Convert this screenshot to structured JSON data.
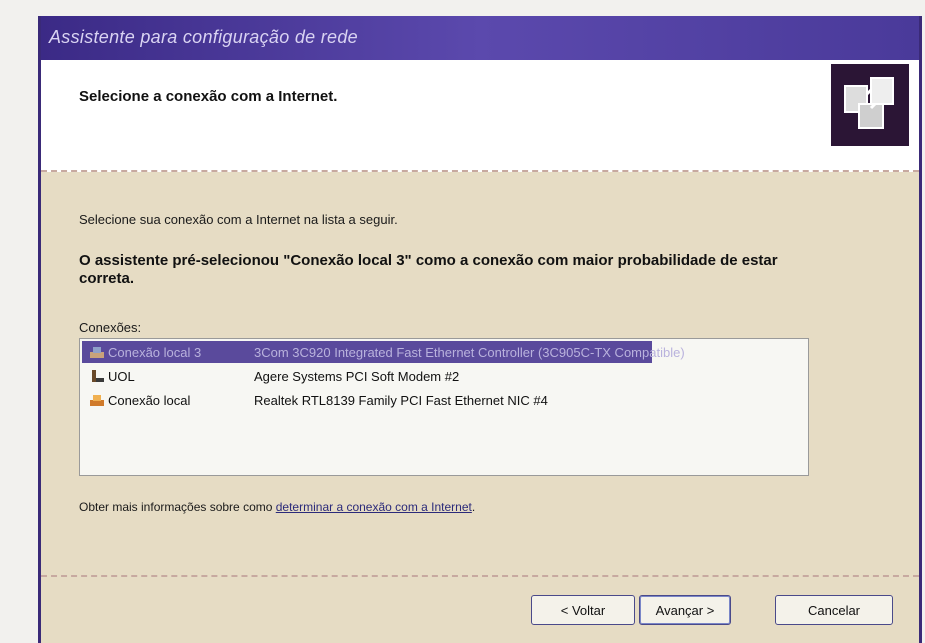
{
  "window": {
    "title": "Assistente para configuração de rede"
  },
  "header": {
    "title": "Selecione a conexão com a Internet.",
    "icon": "network-wizard-icon"
  },
  "content": {
    "intro": "Selecione sua conexão com a Internet na lista a seguir.",
    "note": "O assistente pré-selecionou \"Conexão local 3\" como a conexão com maior probabilidade de estar correta.",
    "list_label": "Conexões:",
    "connections": [
      {
        "name": "Conexão local 3",
        "device": "3Com 3C920 Integrated Fast Ethernet Controller (3C905C-TX Compatible)",
        "icon": "lan-connection-icon",
        "selected": true
      },
      {
        "name": "UOL",
        "device": "Agere Systems PCI Soft Modem #2",
        "icon": "dialup-connection-icon",
        "selected": false
      },
      {
        "name": "Conexão local",
        "device": "Realtek RTL8139 Family PCI Fast Ethernet NIC #4",
        "icon": "lan-connection-icon",
        "selected": false
      }
    ],
    "more_prefix": "Obter mais informações sobre como ",
    "more_link": "determinar a conexão com a Internet",
    "more_suffix": "."
  },
  "footer": {
    "back_label": "< Voltar",
    "next_label": "Avançar >",
    "cancel_label": "Cancelar"
  },
  "colors": {
    "titlebar": "#3b2a86",
    "selection": "#5a4a9c",
    "panel": "#e6dcc4"
  }
}
